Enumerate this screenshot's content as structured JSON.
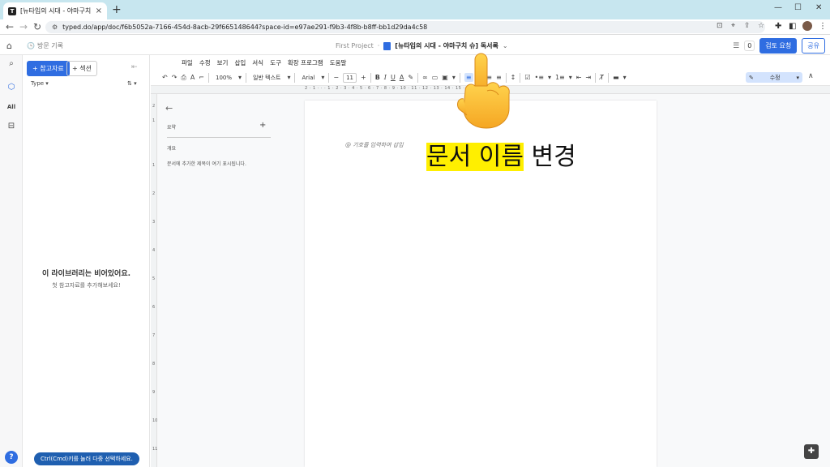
{
  "browser": {
    "tab_title": "[뉴타입의 시대 - 야마구치 슈] 독서록",
    "url": "typed.do/app/doc/f6b5052a-7166-454d-8acb-29f665148644?space-id=e97ae291-f9b3-4f8b-b8ff-bb1d29da4c58"
  },
  "header": {
    "visit_label": "방문 기록",
    "project": "First Project",
    "separator": "·",
    "doc_title": "[뉴타입의 시대 - 야마구치 슈] 독서록",
    "comment_count": "0",
    "review_label": "검토 요청",
    "share_label": "공유"
  },
  "rail": {
    "all_label": "All",
    "help_label": "?"
  },
  "library": {
    "add_ref_label": "+ 참고자료",
    "add_section_label": "+ 섹션",
    "type_filter": "Type ▾",
    "sort_label": "⇅ ▾",
    "empty_title": "이 라이브러리는 비어있어요.",
    "empty_subtitle": "첫 참고자료를 추가해보세요!",
    "ctrl_tip": "Ctrl(Cmd)키를 눌러 다중 선택하세요."
  },
  "menu": [
    "파일",
    "수정",
    "보기",
    "삽입",
    "서식",
    "도구",
    "확장 프로그램",
    "도움말"
  ],
  "toolbar": {
    "zoom": "100%",
    "style": "일반 텍스트",
    "font": "Arial",
    "font_size": "11",
    "mode": "수정"
  },
  "ruler_top": "2 · 1 · · · 1 · 2 · 3 · 4 · 5 · 6 · 7 · 8 · 9 · 10 · 11 · 12 · 13 · 14 · 15 · 16 · 17 · 18",
  "outline": {
    "summary_label": "요약",
    "overview_label": "개요",
    "hint": "문서에 추가한 제목이 여기 표시됩니다."
  },
  "page": {
    "insert_hint": "@ 기호를 입력하여 삽입"
  },
  "caption": {
    "highlight": "문서 이름",
    "rest": " 변경"
  },
  "colors": {
    "accent": "#2f6de1",
    "highlight": "#ffef00",
    "tabbar": "#c7e6ef"
  }
}
